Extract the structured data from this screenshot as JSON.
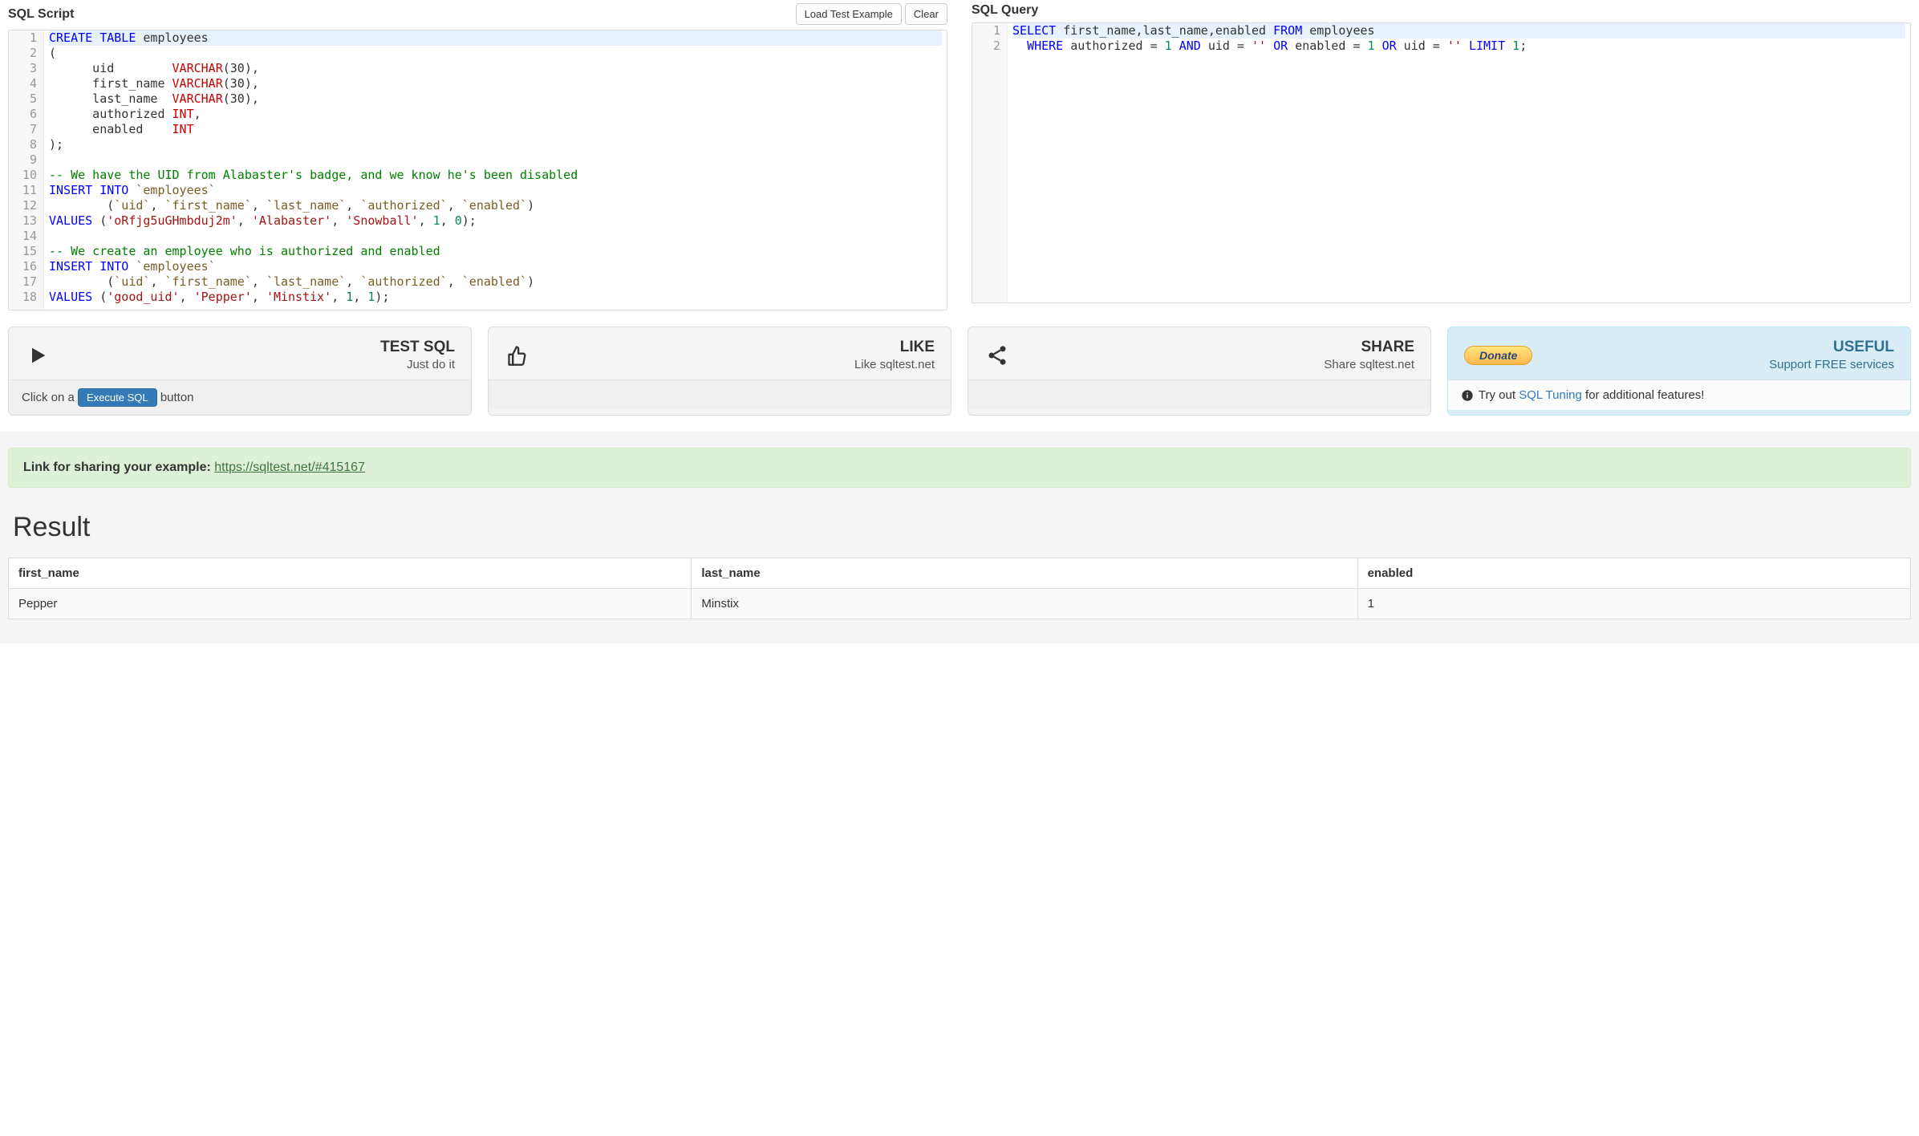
{
  "left": {
    "title": "SQL Script",
    "buttons": {
      "load": "Load Test Example",
      "clear": "Clear"
    },
    "code": [
      {
        "hl": true,
        "tokens": [
          [
            "kw",
            "CREATE"
          ],
          [
            "",
            ""
          ],
          [
            "",
            " "
          ],
          [
            "kw",
            "TABLE"
          ],
          [
            "",
            " employees"
          ]
        ]
      },
      {
        "tokens": [
          [
            "",
            "("
          ]
        ]
      },
      {
        "tokens": [
          [
            "",
            "      uid        "
          ],
          [
            "fn",
            "VARCHAR"
          ],
          [
            "",
            "(30),"
          ]
        ]
      },
      {
        "tokens": [
          [
            "",
            "      first_name "
          ],
          [
            "fn",
            "VARCHAR"
          ],
          [
            "",
            "(30),"
          ]
        ]
      },
      {
        "tokens": [
          [
            "",
            "      last_name  "
          ],
          [
            "fn",
            "VARCHAR"
          ],
          [
            "",
            "(30),"
          ]
        ]
      },
      {
        "tokens": [
          [
            "",
            "      authorized "
          ],
          [
            "fn",
            "INT"
          ],
          [
            "",
            ","
          ]
        ]
      },
      {
        "tokens": [
          [
            "",
            "      enabled    "
          ],
          [
            "fn",
            "INT"
          ]
        ]
      },
      {
        "tokens": [
          [
            "",
            ");"
          ]
        ]
      },
      {
        "tokens": [
          [
            "",
            ""
          ]
        ]
      },
      {
        "tokens": [
          [
            "com",
            "-- We have the UID from Alabaster's badge, and we know he's been disabled"
          ]
        ]
      },
      {
        "tokens": [
          [
            "kw",
            "INSERT"
          ],
          [
            "",
            " "
          ],
          [
            "kw",
            "INTO"
          ],
          [
            "",
            " "
          ],
          [
            "id",
            "`employees`"
          ]
        ]
      },
      {
        "tokens": [
          [
            "",
            "        ("
          ],
          [
            "id",
            "`uid`"
          ],
          [
            "",
            ", "
          ],
          [
            "id",
            "`first_name`"
          ],
          [
            "",
            ", "
          ],
          [
            "id",
            "`last_name`"
          ],
          [
            "",
            ", "
          ],
          [
            "id",
            "`authorized`"
          ],
          [
            "",
            ", "
          ],
          [
            "id",
            "`enabled`"
          ],
          [
            "",
            ")"
          ]
        ]
      },
      {
        "tokens": [
          [
            "kw",
            "VALUES"
          ],
          [
            "",
            " ("
          ],
          [
            "str",
            "'oRfjg5uGHmbduj2m'"
          ],
          [
            "",
            ", "
          ],
          [
            "str",
            "'Alabaster'"
          ],
          [
            "",
            ", "
          ],
          [
            "str",
            "'Snowball'"
          ],
          [
            "",
            ", "
          ],
          [
            "num",
            "1"
          ],
          [
            "",
            ", "
          ],
          [
            "num",
            "0"
          ],
          [
            "",
            ");"
          ]
        ]
      },
      {
        "tokens": [
          [
            "",
            ""
          ]
        ]
      },
      {
        "tokens": [
          [
            "com",
            "-- We create an employee who is authorized and enabled"
          ]
        ]
      },
      {
        "tokens": [
          [
            "kw",
            "INSERT"
          ],
          [
            "",
            " "
          ],
          [
            "kw",
            "INTO"
          ],
          [
            "",
            " "
          ],
          [
            "id",
            "`employees`"
          ]
        ]
      },
      {
        "tokens": [
          [
            "",
            "        ("
          ],
          [
            "id",
            "`uid`"
          ],
          [
            "",
            ", "
          ],
          [
            "id",
            "`first_name`"
          ],
          [
            "",
            ", "
          ],
          [
            "id",
            "`last_name`"
          ],
          [
            "",
            ", "
          ],
          [
            "id",
            "`authorized`"
          ],
          [
            "",
            ", "
          ],
          [
            "id",
            "`enabled`"
          ],
          [
            "",
            ")"
          ]
        ]
      },
      {
        "tokens": [
          [
            "kw",
            "VALUES"
          ],
          [
            "",
            " ("
          ],
          [
            "str",
            "'good_uid'"
          ],
          [
            "",
            ", "
          ],
          [
            "str",
            "'Pepper'"
          ],
          [
            "",
            ", "
          ],
          [
            "str",
            "'Minstix'"
          ],
          [
            "",
            ", "
          ],
          [
            "num",
            "1"
          ],
          [
            "",
            ", "
          ],
          [
            "num",
            "1"
          ],
          [
            "",
            ");"
          ]
        ]
      }
    ]
  },
  "right": {
    "title": "SQL Query",
    "code": [
      {
        "hl": true,
        "tokens": [
          [
            "kw",
            "SELECT"
          ],
          [
            "",
            " first_name,last_name,enabled "
          ],
          [
            "kw",
            "FROM"
          ],
          [
            "",
            " employees"
          ]
        ]
      },
      {
        "tokens": [
          [
            "",
            "  "
          ],
          [
            "kw",
            "WHERE"
          ],
          [
            "",
            " authorized "
          ],
          [
            "op",
            "="
          ],
          [
            "",
            " "
          ],
          [
            "num",
            "1"
          ],
          [
            "",
            " "
          ],
          [
            "kw",
            "AND"
          ],
          [
            "",
            " uid "
          ],
          [
            "op",
            "="
          ],
          [
            "",
            " "
          ],
          [
            "str",
            "''"
          ],
          [
            "",
            " "
          ],
          [
            "kw",
            "OR"
          ],
          [
            "",
            " enabled "
          ],
          [
            "op",
            "="
          ],
          [
            "",
            " "
          ],
          [
            "num",
            "1"
          ],
          [
            "",
            " "
          ],
          [
            "kw",
            "OR"
          ],
          [
            "",
            " uid "
          ],
          [
            "op",
            "="
          ],
          [
            "",
            " "
          ],
          [
            "str",
            "''"
          ],
          [
            "",
            " "
          ],
          [
            "kw",
            "LIMIT"
          ],
          [
            "",
            " "
          ],
          [
            "num",
            "1"
          ],
          [
            "",
            ";"
          ]
        ]
      }
    ]
  },
  "cards": {
    "test": {
      "title": "TEST SQL",
      "sub": "Just do it",
      "footer_pre": "Click on a ",
      "footer_btn": "Execute SQL",
      "footer_post": " button"
    },
    "like": {
      "title": "LIKE",
      "sub": "Like sqltest.net"
    },
    "share": {
      "title": "SHARE",
      "sub": "Share sqltest.net"
    },
    "useful": {
      "donate": "Donate",
      "title": "USEFUL",
      "sub": "Support FREE services",
      "footer_pre": " Try out ",
      "footer_link": "SQL Tuning",
      "footer_post": " for additional features!"
    }
  },
  "share_alert": {
    "label": "Link for sharing your example:",
    "url": "https://sqltest.net/#415167"
  },
  "result": {
    "heading": "Result",
    "columns": [
      "first_name",
      "last_name",
      "enabled"
    ],
    "rows": [
      [
        "Pepper",
        "Minstix",
        "1"
      ]
    ]
  }
}
